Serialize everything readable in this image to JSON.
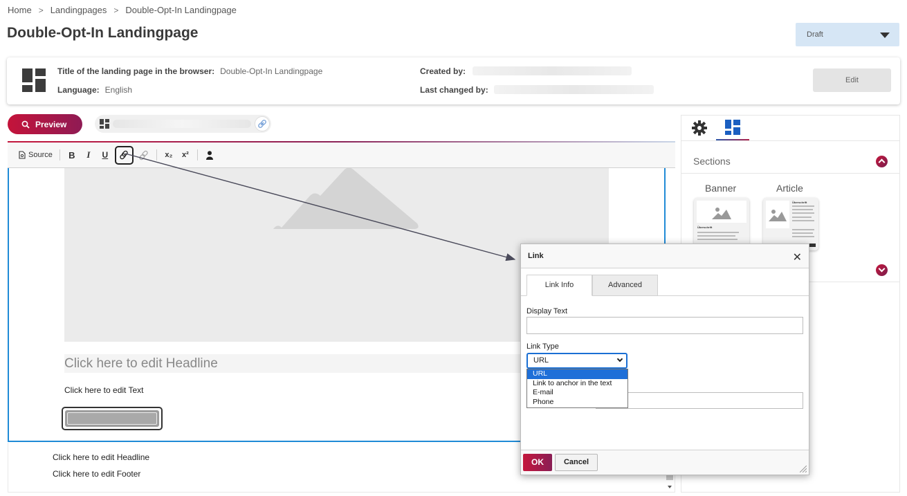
{
  "breadcrumb": {
    "items": [
      "Home",
      "Landingpages",
      "Double-Opt-In Landingpage"
    ],
    "separator": ">"
  },
  "page": {
    "title": "Double-Opt-In Landingpage"
  },
  "status": {
    "selected": "Draft"
  },
  "info": {
    "browser_title_label": "Title of the landing page in the browser:",
    "browser_title_value": "Double-Opt-In Landingpage",
    "language_label": "Language:",
    "language_value": "English",
    "created_by_label": "Created by:",
    "last_changed_label": "Last changed by:",
    "edit_label": "Edit"
  },
  "preview": {
    "label": "Preview"
  },
  "toolbar": {
    "source_label": "Source",
    "bold": "B",
    "italic": "I",
    "underline": "U",
    "subscript": "x₂",
    "superscript": "x²"
  },
  "editor": {
    "headline_placeholder": "Click here to edit Headline",
    "text_placeholder": "Click here to edit Text",
    "footer_headline": "Click here to edit Headline",
    "footer_text": "Click here to edit Footer"
  },
  "right_panel": {
    "sections_title": "Sections",
    "cards": [
      {
        "label": "Banner",
        "heading": "Überschrift"
      },
      {
        "label": "Article",
        "heading": "Überschrift"
      }
    ]
  },
  "dialog": {
    "title": "Link",
    "close": "✕",
    "tabs": [
      "Link Info",
      "Advanced"
    ],
    "display_text_label": "Display Text",
    "display_text_value": "",
    "link_type_label": "Link Type",
    "link_type_selected": "URL",
    "link_type_options": [
      "URL",
      "Link to anchor in the text",
      "E-mail",
      "Phone"
    ],
    "ok_label": "OK",
    "cancel_label": "Cancel"
  },
  "colors": {
    "accent_red": "#c4173c",
    "accent_plum": "#8a1e55",
    "editor_border": "#1f8ad6",
    "status_bg": "#d6e6f5",
    "dropdown_selected": "#1e6fd8"
  }
}
